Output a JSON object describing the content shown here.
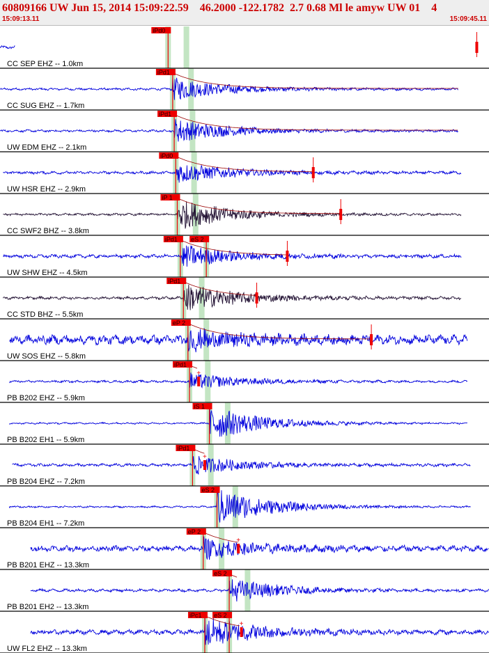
{
  "header": {
    "title": "60809166 UW Jun 15, 2014 15:09:22.59    46.2000 -122.1782  2.7 0.68 Ml le amyw UW 01    4",
    "start_time": "15:09:13.11",
    "end_time": "15:09:45.11"
  },
  "colors": {
    "trace_blue": "#0000dd",
    "trace_dark": "#221133",
    "pick": "#ee0000",
    "envelope": "#990000",
    "window": "#b8e0b8",
    "divider": "#000000"
  },
  "chart_data": {
    "type": "seismogram",
    "x_range": [
      "15:09:13.11",
      "15:09:45.11"
    ],
    "x_duration_s": 32.0,
    "grid": false,
    "traces": [
      {
        "label": "CC SEP EHZ -- 1.0km",
        "amp": 0.85,
        "noise": 0.05,
        "start": 0.0,
        "end": 1.0,
        "env_end": 1.0,
        "color": "blue",
        "picks": [
          {
            "label": "iPd0",
            "t": 11.0
          }
        ],
        "plus": null,
        "spike": 31.2
      },
      {
        "label": "CC SUG EHZ -- 1.7km",
        "amp": 0.55,
        "noise": 0.04,
        "start": 0.0,
        "end": 30.0,
        "env_end": 30.0,
        "color": "blue",
        "picks": [
          {
            "label": "iPd1",
            "t": 11.3
          }
        ],
        "plus": null,
        "spike": null
      },
      {
        "label": "UW EDM EHZ -- 2.1km",
        "amp": 0.6,
        "noise": 0.04,
        "start": 0.0,
        "end": 30.0,
        "env_end": 30.0,
        "color": "blue",
        "picks": [
          {
            "label": "iPd1",
            "t": 11.4
          }
        ],
        "plus": null,
        "spike": null
      },
      {
        "label": "UW HSR EHZ -- 2.9km",
        "amp": 0.5,
        "noise": 0.05,
        "start": 0.2,
        "end": 30.2,
        "env_end": 20.5,
        "color": "blue",
        "picks": [
          {
            "label": "iPd0",
            "t": 11.5
          }
        ],
        "plus": null,
        "spike": 20.5
      },
      {
        "label": "CC SWF2 BHZ -- 3.8km",
        "amp": 0.75,
        "noise": 0.04,
        "start": 0.2,
        "end": 30.2,
        "env_end": 22.3,
        "color": "dark",
        "picks": [
          {
            "label": "iP 1",
            "t": 11.6
          }
        ],
        "plus": null,
        "spike": 22.3
      },
      {
        "label": "UW SHW EHZ -- 4.5km",
        "amp": 0.55,
        "noise": 0.06,
        "start": 0.2,
        "end": 30.2,
        "env_end": 18.8,
        "color": "blue",
        "picks": [
          {
            "label": "iPd1",
            "t": 11.8
          },
          {
            "label": "eS 2",
            "t": 13.5
          }
        ],
        "plus": null,
        "spike": 18.8
      },
      {
        "label": "CC STD BHZ -- 5.5km",
        "amp": 0.7,
        "noise": 0.05,
        "start": 0.2,
        "end": 30.2,
        "env_end": 16.8,
        "color": "dark",
        "picks": [
          {
            "label": "iPd1",
            "t": 12.0
          }
        ],
        "plus": null,
        "spike": 16.8
      },
      {
        "label": "UW SOS EHZ -- 5.8km",
        "amp": 0.45,
        "noise": 0.16,
        "start": 0.6,
        "end": 30.6,
        "env_end": 24.3,
        "color": "blue",
        "picks": [
          {
            "label": "eP 2",
            "t": 12.3
          }
        ],
        "plus": null,
        "spike": 24.3
      },
      {
        "label": "PB B202 EHZ -- 5.9km",
        "amp": 0.4,
        "noise": 0.04,
        "start": 0.6,
        "end": 30.6,
        "env_end": 13.0,
        "color": "blue",
        "picks": [
          {
            "label": "iPd1",
            "t": 12.4
          }
        ],
        "plus": 13.0,
        "spike": null
      },
      {
        "label": "PB B202 EH1 -- 5.9km",
        "amp": 0.85,
        "noise": 0.03,
        "start": 0.6,
        "end": 30.6,
        "env_end": 13.0,
        "color": "blue",
        "picks": [
          {
            "label": "iS 1",
            "t": 13.7
          }
        ],
        "plus": null,
        "spike": null
      },
      {
        "label": "PB B204 EHZ -- 7.2km",
        "amp": 0.45,
        "noise": 0.05,
        "start": 0.8,
        "end": 30.8,
        "env_end": 13.4,
        "color": "blue",
        "picks": [
          {
            "label": "iPd1",
            "t": 12.6
          }
        ],
        "plus": 13.4,
        "spike": null
      },
      {
        "label": "PB B204 EH1 -- 7.2km",
        "amp": 0.9,
        "noise": 0.03,
        "start": 0.6,
        "end": 30.8,
        "env_end": 13.0,
        "color": "blue",
        "picks": [
          {
            "label": "eS 2",
            "t": 14.2
          }
        ],
        "plus": null,
        "spike": null
      },
      {
        "label": "PB B201 EHZ -- 13.3km",
        "amp": 0.45,
        "noise": 0.1,
        "start": 2.0,
        "end": 32.0,
        "env_end": 15.6,
        "color": "blue",
        "picks": [
          {
            "label": "eP 2",
            "t": 13.3
          }
        ],
        "plus": 15.6,
        "spike": null
      },
      {
        "label": "PB B201 EH2 -- 13.3km",
        "amp": 0.55,
        "noise": 0.05,
        "start": 2.0,
        "end": 32.0,
        "env_end": 15.6,
        "color": "blue",
        "picks": [
          {
            "label": "eS 2",
            "t": 15.0
          }
        ],
        "plus": null,
        "spike": null
      },
      {
        "label": "UW FL2 EHZ -- 13.3km",
        "amp": 0.7,
        "noise": 0.08,
        "start": 2.0,
        "end": 32.0,
        "env_end": 15.8,
        "color": "blue",
        "picks": [
          {
            "label": "iPc1",
            "t": 13.4
          },
          {
            "label": "eS 2",
            "t": 15.0
          }
        ],
        "plus": 15.8,
        "spike": null
      }
    ]
  }
}
